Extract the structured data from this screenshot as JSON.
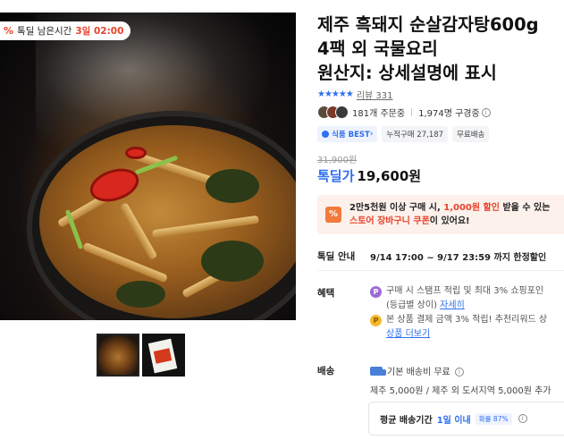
{
  "product": {
    "title_lines": [
      "제주 흑돼지 순살감자탕600g",
      "4팩 외 국물요리",
      "원산지: 상세설명에 표시"
    ],
    "stars": "★★★★★",
    "review_label": "리뷰",
    "review_count": "331",
    "orders": "181개 주문중",
    "watchers": "1,974명 구경중",
    "badges": {
      "best": "식품 BEST",
      "cumulative": "누적구매 27,187",
      "shipping": "무료배송"
    },
    "original_price": "31,900원",
    "price_label": "톡딜가",
    "price": "19,600원"
  },
  "image": {
    "timer_label": "톡딜 남은시간",
    "timer_value": "3일 02:00",
    "pct_icon": "%"
  },
  "coupon": {
    "icon": "%",
    "line1_pre": "2만5천원 이상 구매 시, ",
    "line1_highlight": "1,000원 할인",
    "line1_post": " 받을 수 있는",
    "line2_highlight": "스토어 장바구니 쿠폰",
    "line2_post": "이 있어요!"
  },
  "deal": {
    "label": "톡딜 안내",
    "text": "9/14 17:00 ~ 9/17 23:59 까지 한정할인"
  },
  "benefit": {
    "label": "혜택",
    "item1_icon": "P",
    "item1_line1": "구매 시 스탬프 적립 및 최대 3% 쇼핑포인",
    "item1_line2_pre": "(등급별 상이) ",
    "item1_link": "자세히",
    "item2_icon": "P",
    "item2_line1": "본 상품 결제 금액 3% 적립! 추천리워드 상",
    "item2_link": "상품 더보기"
  },
  "shipping": {
    "label": "배송",
    "base": "기본 배송비 무료",
    "extra": "제주 5,000원 / 제주 외 도서지역 5,000원 추가",
    "avg_label": "평균 배송기간",
    "avg_value": "1일 이내",
    "prob": "확률 87%"
  },
  "icons": {
    "info": "i",
    "truck": "truck-icon",
    "shield": "shield-icon"
  },
  "colors": {
    "accent_blue": "#2f6ff0",
    "discount_red": "#e8432b",
    "coupon_bg": "#fdf1ec"
  }
}
